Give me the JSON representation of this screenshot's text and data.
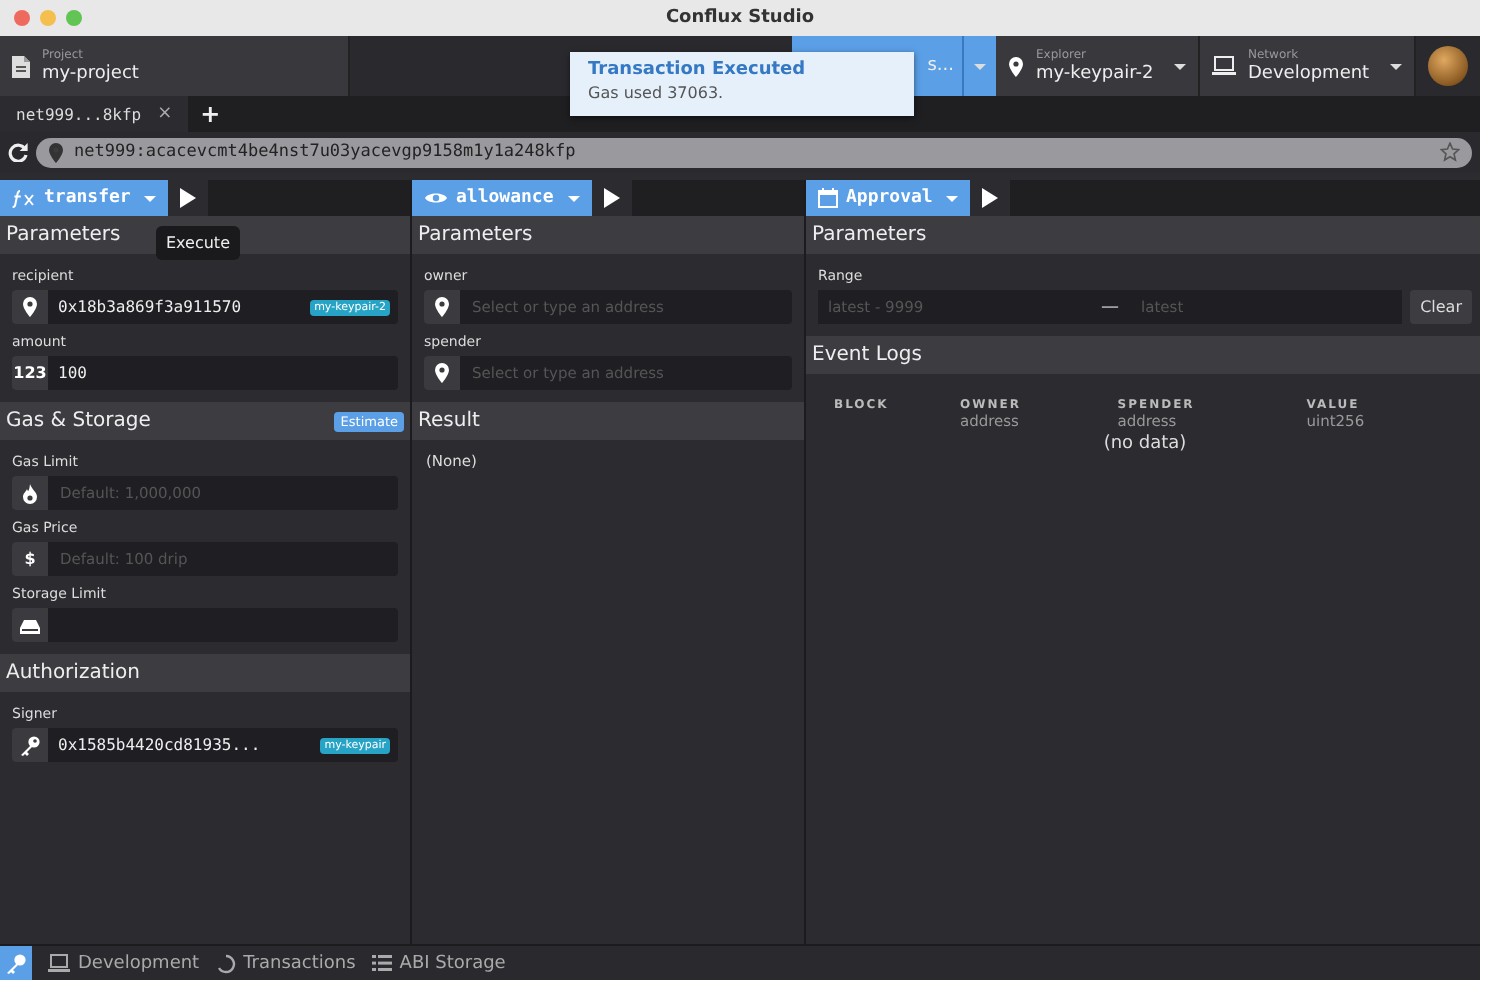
{
  "window": {
    "title": "Conflux Studio"
  },
  "header": {
    "project": {
      "label": "Project",
      "value": "my-project"
    },
    "contract": {
      "value": "s..."
    },
    "explorer": {
      "label": "Explorer",
      "value": "my-keypair-2"
    },
    "network": {
      "label": "Network",
      "value": "Development"
    }
  },
  "toast": {
    "title": "Transaction Executed",
    "message": "Gas used 37063."
  },
  "tabs": [
    {
      "label": "net999...8kfp",
      "close": "×",
      "selected": true
    }
  ],
  "new_tab": "+",
  "address_bar": {
    "value": "net999:acacevcmt4be4nst7u03yacevgp9158m1y1a248kfp"
  },
  "panes": [
    {
      "kind": "write",
      "method": "transfer",
      "tooltip": "Execute",
      "sections": [
        {
          "kind": "fields",
          "title": "Parameters",
          "fields": [
            {
              "kind": "address",
              "label": "recipient",
              "value": "0x18b3a869f3a911570",
              "tag": "my-keypair-2"
            },
            {
              "kind": "number",
              "label": "amount",
              "prefix": "123",
              "value": "100"
            }
          ]
        },
        {
          "kind": "fields",
          "title": "Gas & Storage",
          "action": "Estimate",
          "fields": [
            {
              "kind": "gas",
              "label": "Gas Limit",
              "placeholder": "Default: 1,000,000"
            },
            {
              "kind": "number",
              "label": "Gas Price",
              "prefix": "$",
              "placeholder": "Default: 100 drip"
            },
            {
              "kind": "storage",
              "label": "Storage Limit"
            }
          ]
        },
        {
          "kind": "fields",
          "title": "Authorization",
          "fields": [
            {
              "kind": "signer",
              "label": "Signer",
              "value": "0x1585b4420cd81935...",
              "tag": "my-keypair"
            }
          ]
        }
      ]
    },
    {
      "kind": "read",
      "method": "allowance",
      "sections": [
        {
          "kind": "fields",
          "title": "Parameters",
          "fields": [
            {
              "kind": "address",
              "label": "owner",
              "placeholder": "Select or type an address"
            },
            {
              "kind": "address",
              "label": "spender",
              "placeholder": "Select or type an address"
            }
          ]
        },
        {
          "kind": "result",
          "title": "Result",
          "text": "(None)"
        }
      ]
    },
    {
      "kind": "event",
      "method": "Approval",
      "sections": [
        {
          "kind": "range",
          "title": "Parameters",
          "label": "Range",
          "from": "latest - 9999",
          "separator": "—",
          "to": "latest",
          "button": "Clear"
        },
        {
          "kind": "table",
          "title": "Event Logs",
          "columns": [
            {
              "name": "BLOCK"
            },
            {
              "name": "OWNER",
              "type": "address"
            },
            {
              "name": "SPENDER",
              "type": "address"
            },
            {
              "name": "VALUE",
              "type": "uint256"
            }
          ],
          "empty": "(no data)"
        }
      ]
    }
  ],
  "status_bar": {
    "items": [
      "Development",
      "Transactions",
      "ABI Storage"
    ]
  }
}
